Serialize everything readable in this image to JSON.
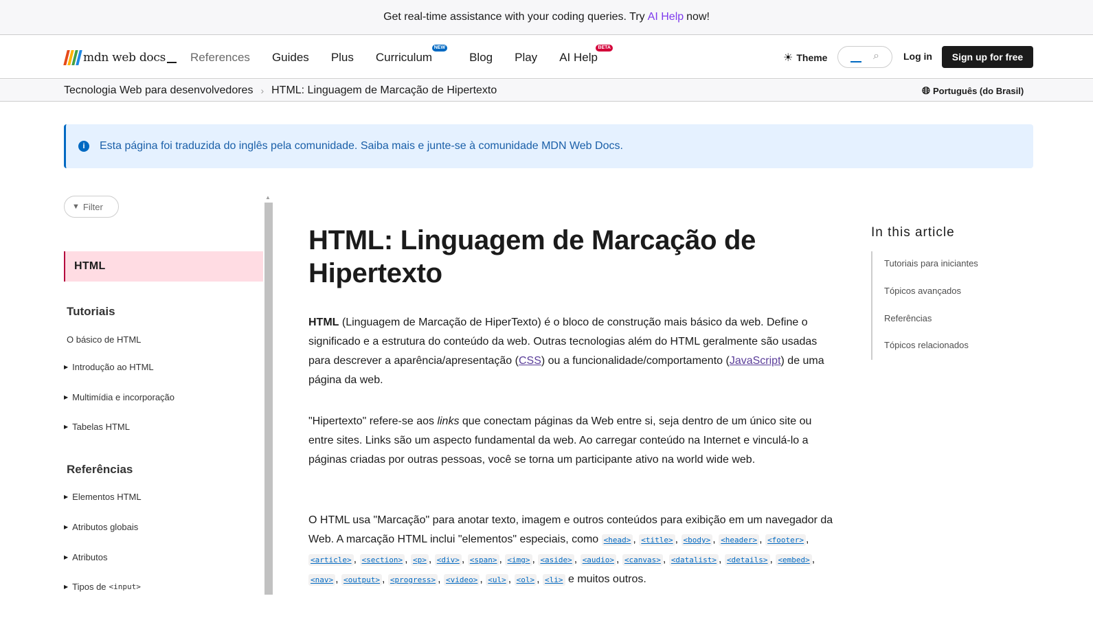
{
  "banner": {
    "text_before": "Get real-time assistance with your coding queries. Try",
    "link": "AI Help",
    "text_after": "now!"
  },
  "nav": {
    "logo_text": "mdn web docs",
    "items": [
      {
        "label": "References"
      },
      {
        "label": "Guides"
      },
      {
        "label": "Plus"
      },
      {
        "label": "Curriculum",
        "badge": "NEW"
      },
      {
        "label": "Blog"
      },
      {
        "label": "Play"
      },
      {
        "label": "AI Help",
        "badge": "BETA"
      }
    ],
    "theme_label": "Theme",
    "login_label": "Log in",
    "signup_label": "Sign up for free"
  },
  "breadcrumb": {
    "items": [
      "Tecnologia Web para desenvolvedores",
      "HTML: Linguagem de Marcação de Hipertexto"
    ],
    "language": "Português (do Brasil)"
  },
  "notice": {
    "text": "Esta página foi traduzida do inglês pela comunidade. Saiba mais e junte-se à comunidade MDN Web Docs."
  },
  "sidebar": {
    "filter_label": "Filter",
    "active": "HTML",
    "sections": [
      {
        "heading": "Tutoriais",
        "items": [
          "O básico de HTML",
          "Introdução ao HTML",
          "Multimídia e incorporação",
          "Tabelas HTML"
        ]
      },
      {
        "heading": "Referências",
        "items": [
          "Elementos HTML",
          "Atributos globais",
          "Atributos",
          "Tipos de"
        ]
      }
    ],
    "input_code": "<input>"
  },
  "article": {
    "title": "HTML: Linguagem de Marcação de Hipertexto",
    "p1": {
      "strong": "HTML",
      "t1": " (Linguagem de Marcação de HiperTexto) é o bloco de construção mais básico da web. Define o significado e a estrutura do conteúdo da web. Outras tecnologias além do HTML geralmente são usadas para descrever a aparência/apresentação (",
      "link1": "CSS",
      "t2": ") ou a funcionalidade/comportamento (",
      "link2": "JavaScript",
      "t3": ") de uma página da web."
    },
    "p2": {
      "t1": "\"Hipertexto\" refere-se aos ",
      "em": "links",
      "t2": " que conectam páginas da Web entre si, seja dentro de um único site ou entre sites. Links são um aspecto fundamental da web. Ao carregar conteúdo na Internet e vinculá-lo a páginas criadas por outras pessoas, você se torna um participante ativo na world wide web."
    },
    "p3": {
      "t1": "O HTML usa \"Marcação\" para anotar texto, imagem e outros conteúdos para exibição em um navegador da Web. A marcação HTML inclui \"elementos\" especiais, como ",
      "tags": [
        "<head>",
        "<title>",
        "<body>",
        "<header>",
        "<footer>",
        "<article>",
        "<section>",
        "<p>",
        "<div>",
        "<span>",
        "<img>",
        "<aside>",
        "<audio>",
        "<canvas>",
        "<datalist>",
        "<details>",
        "<embed>",
        "<nav>",
        "<output>",
        "<progress>",
        "<video>",
        "<ul>",
        "<ol>",
        "<li>"
      ],
      "t2": " e muitos outros."
    }
  },
  "toc": {
    "title": "In this article",
    "items": [
      "Tutoriais para iniciantes",
      "Tópicos avançados",
      "Referências",
      "Tópicos relacionados"
    ]
  },
  "colors": {
    "accent_purple": "#7e3bed",
    "link_blue": "#0069c2",
    "active_pink": "#ffdce3",
    "notice_bg": "#e5f1ff"
  }
}
